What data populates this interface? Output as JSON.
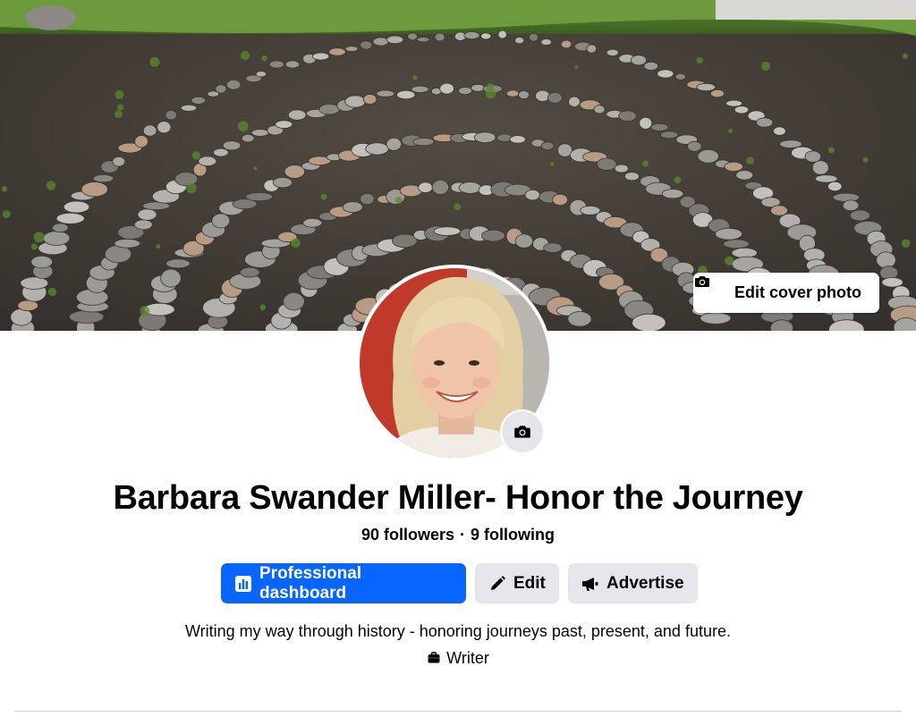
{
  "cover": {
    "edit_cover_label": "Edit cover photo"
  },
  "profile": {
    "name": "Barbara Swander Miller- Honor the Journey",
    "followers": "90 followers",
    "separator": "·",
    "following": "9 following",
    "bio": "Writing my way through history - honoring journeys past, present, and future.",
    "category": "Writer"
  },
  "actions": {
    "dashboard_label": "Professional dashboard",
    "edit_label": "Edit",
    "advertise_label": "Advertise"
  },
  "colors": {
    "primary": "#0866ff",
    "secondary_button": "#e4e6eb",
    "text": "#050505"
  },
  "icons": {
    "cover_camera": "camera-icon",
    "avatar_camera": "camera-icon",
    "dashboard": "bar-chart-icon",
    "edit": "pencil-icon",
    "advertise": "megaphone-icon",
    "category": "briefcase-icon"
  }
}
